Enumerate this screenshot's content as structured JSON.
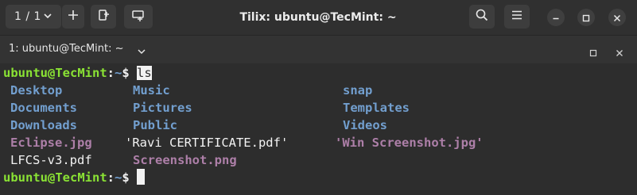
{
  "titlebar": {
    "session_count": "1 / 1",
    "title": "Tilix: ubuntu@TecMint: ~",
    "icons": {
      "session_chevron": "chevron-down-icon",
      "add": "plus-icon",
      "split_horizontal": "split-horizontal-icon",
      "split_vertical": "split-vertical-icon",
      "search": "search-icon",
      "menu": "hamburger-menu-icon",
      "minimize": "minimize-icon",
      "maximize": "maximize-icon",
      "close": "close-icon"
    }
  },
  "tab": {
    "title": "1: ubuntu@TecMint: ~"
  },
  "terminal": {
    "prompt": {
      "user_host": "ubuntu@TecMint",
      "separator": ":",
      "path": "~",
      "symbol": "$"
    },
    "command": "ls",
    "listing": {
      "col1": [
        {
          "name": "Desktop",
          "kind": "dir"
        },
        {
          "name": "Documents",
          "kind": "dir"
        },
        {
          "name": "Downloads",
          "kind": "dir"
        },
        {
          "name": "Eclipse.jpg",
          "kind": "image"
        },
        {
          "name": "LFCS-v3.pdf",
          "kind": "file"
        }
      ],
      "col2": [
        {
          "name": "Music",
          "kind": "dir"
        },
        {
          "name": "Pictures",
          "kind": "dir"
        },
        {
          "name": "Public",
          "kind": "dir"
        },
        {
          "name": "'Ravi CERTIFICATE.pdf'",
          "kind": "file"
        },
        {
          "name": "Screenshot.png",
          "kind": "image"
        }
      ],
      "col3": [
        {
          "name": "snap",
          "kind": "dir"
        },
        {
          "name": "Templates",
          "kind": "dir"
        },
        {
          "name": "Videos",
          "kind": "dir"
        },
        {
          "name": "'Win Screenshot.jpg'",
          "kind": "image"
        }
      ]
    },
    "colors": {
      "user_host": "#8ae234",
      "path": "#729fcf",
      "directory": "#729fcf",
      "image": "#ad7fa8",
      "text": "#f2f2f2",
      "background": "#2d2d2d"
    }
  }
}
